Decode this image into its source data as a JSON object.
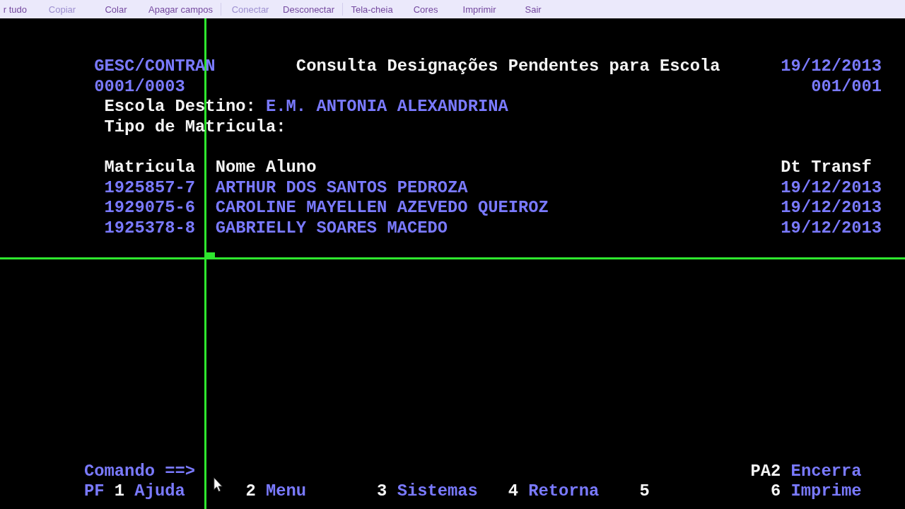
{
  "toolbar": {
    "groups": [
      [
        {
          "label": "r tudo",
          "disabled": false
        },
        {
          "label": "Copiar",
          "disabled": true
        },
        {
          "label": "Colar",
          "disabled": false
        },
        {
          "label": "Apagar campos",
          "disabled": false
        }
      ],
      [
        {
          "label": "Conectar",
          "disabled": true
        },
        {
          "label": "Desconectar",
          "disabled": false
        }
      ],
      [
        {
          "label": "Tela-cheia",
          "disabled": false
        },
        {
          "label": "Cores",
          "disabled": false
        },
        {
          "label": "Imprimir",
          "disabled": false
        },
        {
          "label": "Sair",
          "disabled": false
        }
      ]
    ]
  },
  "terminal": {
    "header": {
      "system": "GESC/CONTRAN",
      "title": "Consulta Designações Pendentes para Escola",
      "date": "19/12/2013",
      "record_counter": "0001/0003",
      "page_counter": "001/001"
    },
    "fields": [
      {
        "label": "Escola Destino:",
        "value": "E.M. ANTONIA ALEXANDRINA"
      },
      {
        "label": "Tipo de Matricula:"
      }
    ],
    "table": {
      "columns": [
        "Matricula",
        "Nome Aluno",
        "Dt Transf"
      ],
      "rows": [
        [
          "1925857-7",
          "ARTHUR DOS SANTOS PEDROZA",
          "19/12/2013"
        ],
        [
          "1929075-6",
          "CAROLINE MAYELLEN AZEVEDO QUEIROZ",
          "19/12/2013"
        ],
        [
          "1925378-8",
          "GABRIELLY SOARES MACEDO",
          "19/12/2013"
        ]
      ]
    },
    "command": {
      "label": "Comando ==>"
    },
    "pa_key": {
      "key": "PA2",
      "label": "Encerra"
    },
    "pf_keys": {
      "prefix": "PF",
      "keys": [
        {
          "key": "1",
          "label": "Ajuda"
        },
        {
          "key": "2",
          "label": "Menu"
        },
        {
          "key": "3",
          "label": "Sistemas"
        },
        {
          "key": "4",
          "label": "Retorna"
        },
        {
          "key": "5"
        },
        {
          "key": "6",
          "label": "Imprime"
        }
      ]
    }
  }
}
